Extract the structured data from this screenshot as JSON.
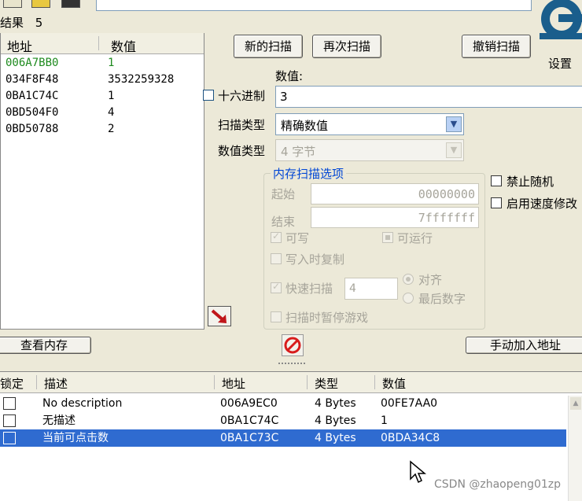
{
  "top": {
    "results_label": "结果",
    "results_count": "5"
  },
  "results_list": {
    "headers": {
      "address": "地址",
      "value": "数值"
    },
    "rows": [
      {
        "address": "006A7BB0",
        "value": "1"
      },
      {
        "address": "034F8F48",
        "value": "3532259328"
      },
      {
        "address": "0BA1C74C",
        "value": "1"
      },
      {
        "address": "0BD504F0",
        "value": "4"
      },
      {
        "address": "0BD50788",
        "value": "2"
      }
    ]
  },
  "scan": {
    "new_scan": "新的扫描",
    "next_scan": "再次扫描",
    "undo_scan": "撤销扫描",
    "settings": "设置",
    "value_label": "数值:",
    "hex_label": "十六进制",
    "value": "3",
    "scan_type_label": "扫描类型",
    "scan_type": "精确数值",
    "value_type_label": "数值类型",
    "value_type": "4 字节"
  },
  "memory_options": {
    "title": "内存扫描选项",
    "start_label": "起始",
    "start_value": "00000000",
    "stop_label": "结束",
    "stop_value": "7fffffff",
    "writable": "可写",
    "executable": "可运行",
    "copy_on_write": "写入时复制",
    "fast_scan": "快速扫描",
    "fast_scan_value": "4",
    "align": "对齐",
    "last_digits": "最后数字",
    "pause_game": "扫描时暂停游戏"
  },
  "extra_options": {
    "no_random": "禁止随机",
    "speedhack": "启用速度修改"
  },
  "bottom_buttons": {
    "view_memory": "查看内存",
    "add_address": "手动加入地址"
  },
  "address_list": {
    "headers": {
      "freeze": "锁定",
      "description": "描述",
      "address": "地址",
      "type": "类型",
      "value": "数值"
    },
    "rows": [
      {
        "description": "No description",
        "address": "006A9EC0",
        "type": "4 Bytes",
        "value": "00FE7AA0",
        "selected": false
      },
      {
        "description": "无描述",
        "address": "0BA1C74C",
        "type": "4 Bytes",
        "value": "1",
        "selected": false
      },
      {
        "description": "当前可点击数",
        "address": "0BA1C73C",
        "type": "4 Bytes",
        "value": "0BDA34C8",
        "selected": true
      }
    ]
  },
  "watermark": "CSDN @zhaopeng01zp",
  "colors": {
    "selection": "#2f6bd0",
    "first_row": "#1e8a1e",
    "logo": "#1a5e8c"
  }
}
